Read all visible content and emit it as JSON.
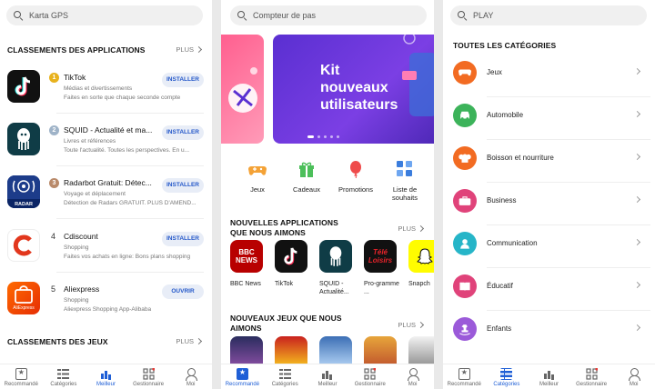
{
  "panel1": {
    "search_placeholder": "Karta GPS",
    "section_apps": "CLASSEMENTS DES APPLICATIONS",
    "plus": "PLUS",
    "apps": [
      {
        "rank": "1",
        "name": "TikTok",
        "category": "Médias et divertissements",
        "description": "Faites en sorte que chaque seconde compte",
        "button": "INSTALLER",
        "color": "#111111"
      },
      {
        "rank": "2",
        "name": "SQUID - Actualité et ma...",
        "category": "Livres et références",
        "description": "Toute l'actualité. Toutes les perspectives. En u...",
        "button": "INSTALLER",
        "color": "#0f3c46"
      },
      {
        "rank": "3",
        "name": "Radarbot Gratuit: Détec...",
        "category": "Voyage et déplacement",
        "description": "Détection de Radars GRATUIT. PLUS D'AMEND...",
        "button": "INSTALLER",
        "color": "#1d3c8a"
      },
      {
        "rank": "4",
        "name": "Cdiscount",
        "category": "Shopping",
        "description": "Faites vos achats en ligne: Bons plans shopping",
        "button": "INSTALLER",
        "color": "#ffffff"
      },
      {
        "rank": "5",
        "name": "Aliexpress",
        "category": "Shopping",
        "description": "Aliexpress Shopping App-Alibaba",
        "button": "OUVRIR",
        "color": "#e62e04"
      }
    ],
    "section_games": "CLASSEMENTS DES JEUX",
    "radar_label": "RADAR",
    "ali_label": "AliExpress"
  },
  "panel2": {
    "search_placeholder": "Compteur de pas",
    "banner_text": [
      "Kit",
      "nouveaux",
      "utilisateurs"
    ],
    "quick": [
      {
        "label": "Jeux",
        "icon": "gamepad-icon",
        "color": "#f4a236"
      },
      {
        "label": "Cadeaux",
        "icon": "gift-icon",
        "color": "#4cbf5a"
      },
      {
        "label": "Promotions",
        "icon": "balloon-icon",
        "color": "#ef4b4b"
      },
      {
        "label": "Liste de souhaits",
        "icon": "wishlist-icon",
        "color": "#3b7ddd"
      }
    ],
    "section_new_apps": "NOUVELLES APPLICATIONS QUE NOUS AIMONS",
    "section_new_games": "NOUVEAUX JEUX QUE NOUS AIMONS",
    "plus": "PLUS",
    "tiles": [
      {
        "label": "BBC News",
        "color": "#b80000"
      },
      {
        "label": "TikTok",
        "color": "#111111"
      },
      {
        "label": "SQUID - Actualité...",
        "color": "#0f3c46"
      },
      {
        "label": "Pro-gramme ...",
        "color": "#111111"
      },
      {
        "label": "Snapch",
        "color": "#fffc00"
      }
    ],
    "bbc_lines": [
      "BBC",
      "NEWS"
    ],
    "tele_lines": [
      "Télé",
      "Loisirs"
    ]
  },
  "panel3": {
    "search_placeholder": "PLAY",
    "section_title": "TOUTES LES CATÉGORIES",
    "categories": [
      {
        "label": "Jeux",
        "icon": "gamepad-icon",
        "color": "#f26b22"
      },
      {
        "label": "Automobile",
        "icon": "car-icon",
        "color": "#3cb35a"
      },
      {
        "label": "Boisson et nourriture",
        "icon": "chef-hat-icon",
        "color": "#f26b22"
      },
      {
        "label": "Business",
        "icon": "briefcase-icon",
        "color": "#e0437a"
      },
      {
        "label": "Communication",
        "icon": "contact-icon",
        "color": "#26b5c8"
      },
      {
        "label": "Éducatif",
        "icon": "book-icon",
        "color": "#e0437a"
      },
      {
        "label": "Enfants",
        "icon": "rocking-horse-icon",
        "color": "#9b5ad9"
      }
    ]
  },
  "nav": [
    {
      "label": "Recommandé"
    },
    {
      "label": "Catégories"
    },
    {
      "label": "Meilleur"
    },
    {
      "label": "Gestionnaire"
    },
    {
      "label": "Moi"
    }
  ]
}
